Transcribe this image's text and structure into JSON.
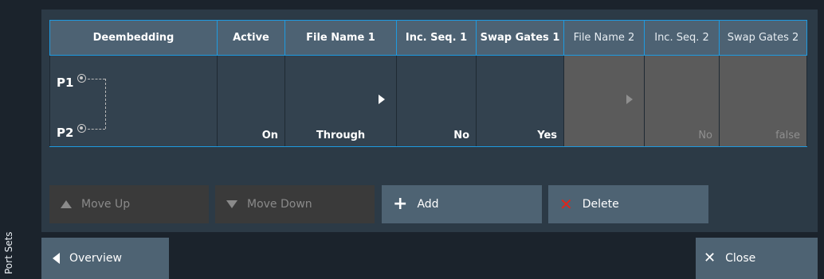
{
  "side_panel": {
    "label": "Port Sets"
  },
  "table": {
    "headers": [
      "Deembedding",
      "Active",
      "File Name 1",
      "Inc. Seq. 1",
      "Swap Gates 1",
      "File Name 2",
      "Inc. Seq. 2",
      "Swap Gates 2"
    ],
    "row": {
      "port1": "P1",
      "port2": "P2",
      "active": "On",
      "file_name_1": "Through",
      "inc_seq_1": "No",
      "swap_gates_1": "Yes",
      "file_name_2": "",
      "inc_seq_2": "No",
      "swap_gates_2": "false"
    }
  },
  "buttons": {
    "move_up": "Move Up",
    "move_down": "Move Down",
    "add": "Add",
    "delete": "Delete",
    "overview": "Overview",
    "close": "Close"
  },
  "colors": {
    "header_bg": "#4d6273",
    "selected_border": "#1e9ae0",
    "disabled_cell": "#5b5b5b",
    "delete_icon": "#e0251b"
  }
}
